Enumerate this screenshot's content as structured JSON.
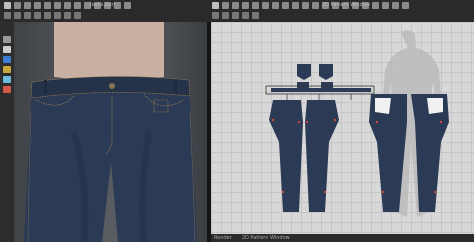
{
  "window_titles": {
    "view3d": "Jeans.Zprj",
    "view2d": "2D Pattern Window"
  },
  "statusbar": {
    "left_tab": "Render",
    "right_tab": "2D Pattern Window"
  },
  "colors": {
    "denim": "#2b3a55",
    "denim_dark": "#1e2a40",
    "stitch": "#b08a52",
    "skin": "#c9b0a3",
    "grid_bg": "#d8d8d8",
    "avatar_silhouette": "#b9b9b9"
  },
  "icons": {
    "toolbar_3d": [
      "select-icon",
      "move-icon",
      "rotate-icon",
      "scale-icon",
      "pin-icon",
      "tack-icon",
      "measure-icon",
      "camera-icon"
    ],
    "toolbar_2d": [
      "transform-icon",
      "edit-point-icon",
      "curve-icon",
      "segment-icon",
      "sewing-icon",
      "internal-line-icon",
      "dart-icon",
      "notch-icon"
    ]
  }
}
